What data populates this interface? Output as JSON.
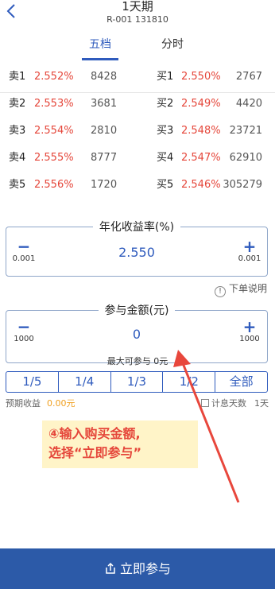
{
  "header": {
    "title": "1天期",
    "code": "R-001 131810"
  },
  "tabs": [
    {
      "label": "五档",
      "active": true
    },
    {
      "label": "分时",
      "active": false
    }
  ],
  "order_book": {
    "sell": [
      {
        "label": "卖1",
        "rate": "2.552%",
        "volume": "8428"
      },
      {
        "label": "卖2",
        "rate": "2.553%",
        "volume": "3681"
      },
      {
        "label": "卖3",
        "rate": "2.554%",
        "volume": "2810"
      },
      {
        "label": "卖4",
        "rate": "2.555%",
        "volume": "8777"
      },
      {
        "label": "卖5",
        "rate": "2.556%",
        "volume": "1720"
      }
    ],
    "buy": [
      {
        "label": "买1",
        "rate": "2.550%",
        "volume": "2767"
      },
      {
        "label": "买2",
        "rate": "2.549%",
        "volume": "4420"
      },
      {
        "label": "买3",
        "rate": "2.548%",
        "volume": "23721"
      },
      {
        "label": "买4",
        "rate": "2.547%",
        "volume": "62910"
      },
      {
        "label": "买5",
        "rate": "2.546%",
        "volume": "305279"
      }
    ]
  },
  "rate_box": {
    "legend": "年化收益率(%)",
    "value": "2.550",
    "minus_step": "0.001",
    "plus_step": "0.001",
    "minus": "−",
    "plus": "+"
  },
  "help": {
    "icon": "!",
    "label": "下单说明"
  },
  "amount_box": {
    "legend": "参与金额(元)",
    "value": "0",
    "minus_step": "1000",
    "plus_step": "1000",
    "minus": "−",
    "plus": "+"
  },
  "max_line": "最大可参与 0元",
  "ratios": [
    "1/5",
    "1/4",
    "1/3",
    "1/2",
    "全部"
  ],
  "expected": {
    "label": "预期收益",
    "amount": "0.00元"
  },
  "days": {
    "label": "计息天数",
    "value": "1天"
  },
  "annotation": {
    "line1": "④输入购买金额,",
    "line2": "选择“立即参与”"
  },
  "submit": {
    "label": "立即参与"
  },
  "colors": {
    "accent": "#2f5bbd",
    "rate_red": "#e5463a",
    "annotation_bg": "#fff4c8",
    "submit_bg": "#2c5aa8"
  }
}
